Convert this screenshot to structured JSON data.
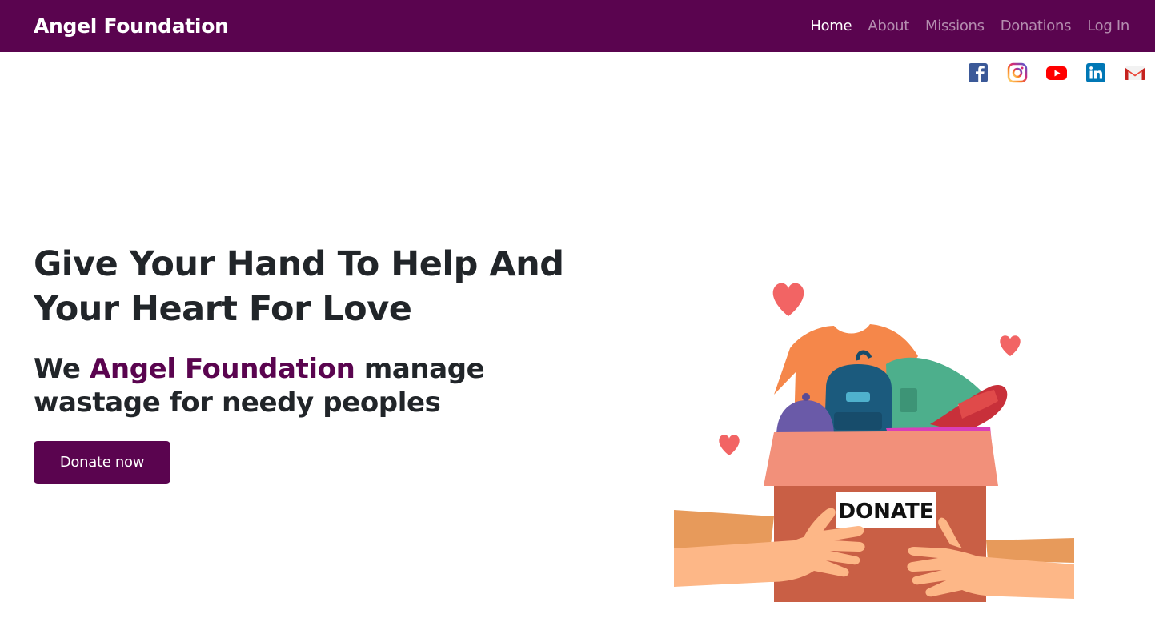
{
  "navbar": {
    "brand": "Angel Foundation",
    "links": [
      {
        "label": "Home",
        "active": true
      },
      {
        "label": "About",
        "active": false
      },
      {
        "label": "Missions",
        "active": false
      },
      {
        "label": "Donations",
        "active": false
      },
      {
        "label": "Log In",
        "active": false
      }
    ]
  },
  "social": [
    {
      "icon": "facebook-icon"
    },
    {
      "icon": "instagram-icon"
    },
    {
      "icon": "youtube-icon"
    },
    {
      "icon": "linkedin-icon"
    },
    {
      "icon": "gmail-icon"
    }
  ],
  "hero": {
    "headline_line1": "Give Your Hand To Help And",
    "headline_line2": "Your Heart For Love",
    "sub_prefix": "We ",
    "sub_accent": "Angel Foundation",
    "sub_suffix": " manage wastage for needy peoples",
    "button_label": "Donate now"
  },
  "illustration": {
    "box_label": "DONATE"
  },
  "colors": {
    "brand": "#5a044f",
    "text": "#212529"
  }
}
